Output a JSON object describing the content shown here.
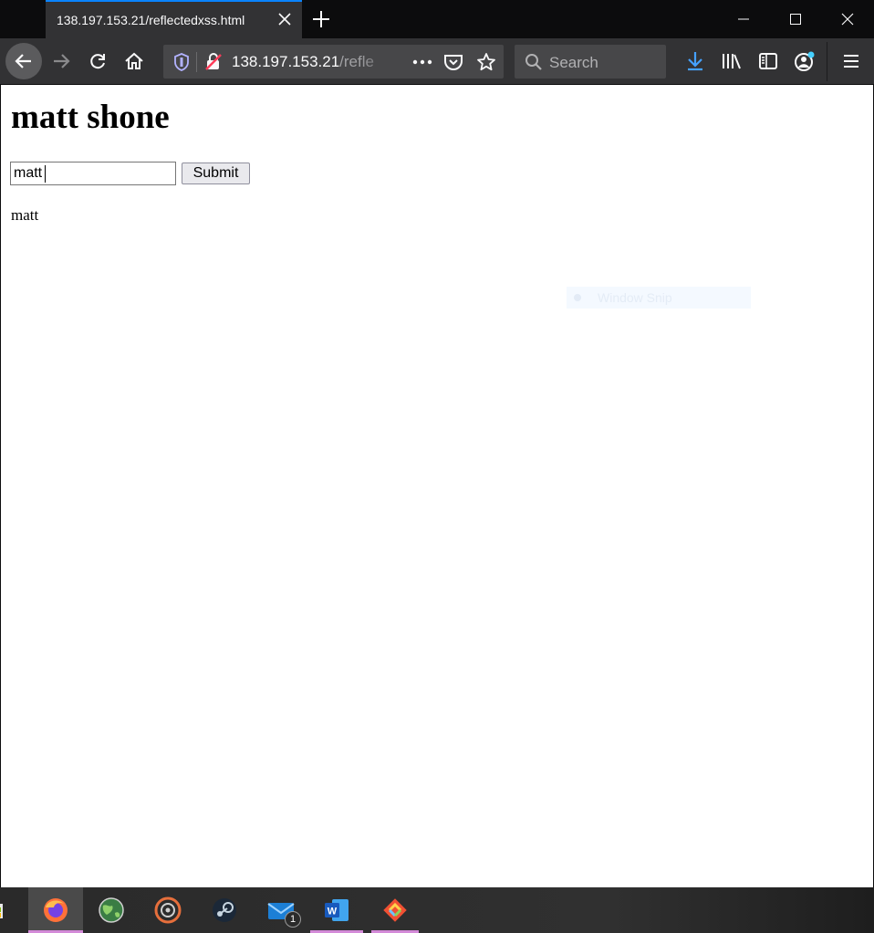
{
  "browser": {
    "tab": {
      "title": "138.197.153.21/reflectedxss.html"
    },
    "url": {
      "host": "138.197.153.21",
      "path_visible": "/refle"
    },
    "search": {
      "placeholder": "Search"
    }
  },
  "page": {
    "heading": "matt shone",
    "form": {
      "input_value": "matt",
      "submit_label": "Submit"
    },
    "reflected_output": "matt",
    "overlay_text": "Window Snip"
  },
  "taskbar": {
    "items": [
      {
        "icon": "store-icon"
      },
      {
        "icon": "firefox-icon",
        "active": true
      },
      {
        "icon": "globe-icon"
      },
      {
        "icon": "music-player-icon"
      },
      {
        "icon": "steam-icon"
      },
      {
        "icon": "mail-icon",
        "badge": "1"
      },
      {
        "icon": "word-icon"
      },
      {
        "icon": "git-icon"
      }
    ]
  },
  "colors": {
    "accent": "#0a84ff",
    "toolbar": "#323234",
    "titlebar": "#0c0c0d",
    "taskbar_indicator": "#d38ad8"
  }
}
